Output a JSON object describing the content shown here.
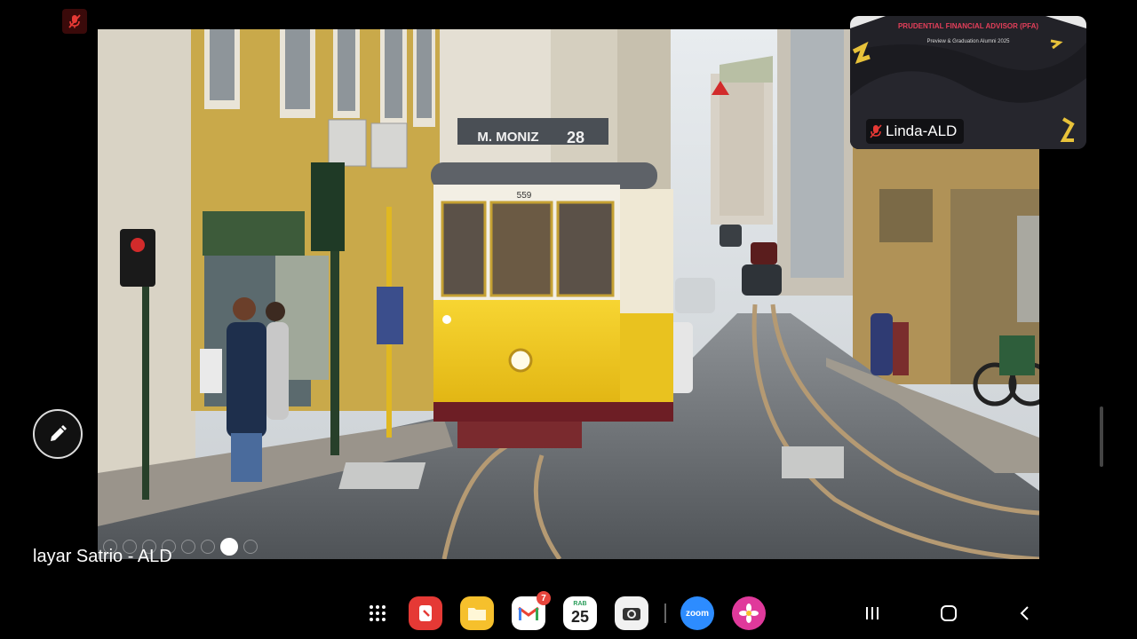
{
  "shared_screen": {
    "tram_route_sign": "M. MONIZ",
    "tram_route_number": "28",
    "tram_car_number": "559"
  },
  "presenter": {
    "label": "layar Satrio - ALD"
  },
  "participant": {
    "name": "Linda-ALD",
    "banner_title": "PRUDENTIAL FINANCIAL ADVISOR (PFA)",
    "banner_subtitle": "Preview & Graduation Alumni 2025"
  },
  "taskbar": {
    "apps": [
      {
        "name": "app-drawer-icon"
      },
      {
        "name": "notes-icon",
        "color": "#e53935"
      },
      {
        "name": "files-icon",
        "color": "#f6c02c"
      },
      {
        "name": "gmail-icon",
        "badge": "7"
      },
      {
        "name": "calendar-icon",
        "day_label": "RAB",
        "day": "25"
      },
      {
        "name": "camera-icon"
      },
      {
        "name": "zoom-icon",
        "label": "zoom",
        "color": "#2d8cff"
      },
      {
        "name": "gallery-icon",
        "color": "#e0399b"
      }
    ],
    "nav": [
      "recent-apps-icon",
      "home-icon",
      "back-icon"
    ]
  },
  "colors": {
    "muted_mic": "#e53935",
    "accent_yellow": "#f2c41c"
  }
}
